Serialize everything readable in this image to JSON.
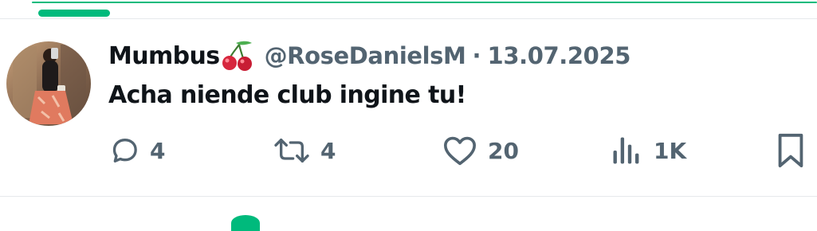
{
  "colors": {
    "accent": "#00ba7c",
    "secondary_text": "#536471",
    "primary_text": "#0f1419",
    "divider": "#e6e9ec"
  },
  "post": {
    "display_name": "Mumbus",
    "name_emoji": "cherry-icon",
    "handle": "@RoseDanielsM",
    "separator": "·",
    "date": "13.07.2025",
    "text": "Acha niende club ingine tu!",
    "actions": {
      "reply": {
        "icon": "reply-icon",
        "count": "4"
      },
      "repost": {
        "icon": "repost-icon",
        "count": "4"
      },
      "like": {
        "icon": "heart-icon",
        "count": "20"
      },
      "views": {
        "icon": "views-icon",
        "count": "1K"
      },
      "bookmark": {
        "icon": "bookmark-icon"
      }
    }
  }
}
